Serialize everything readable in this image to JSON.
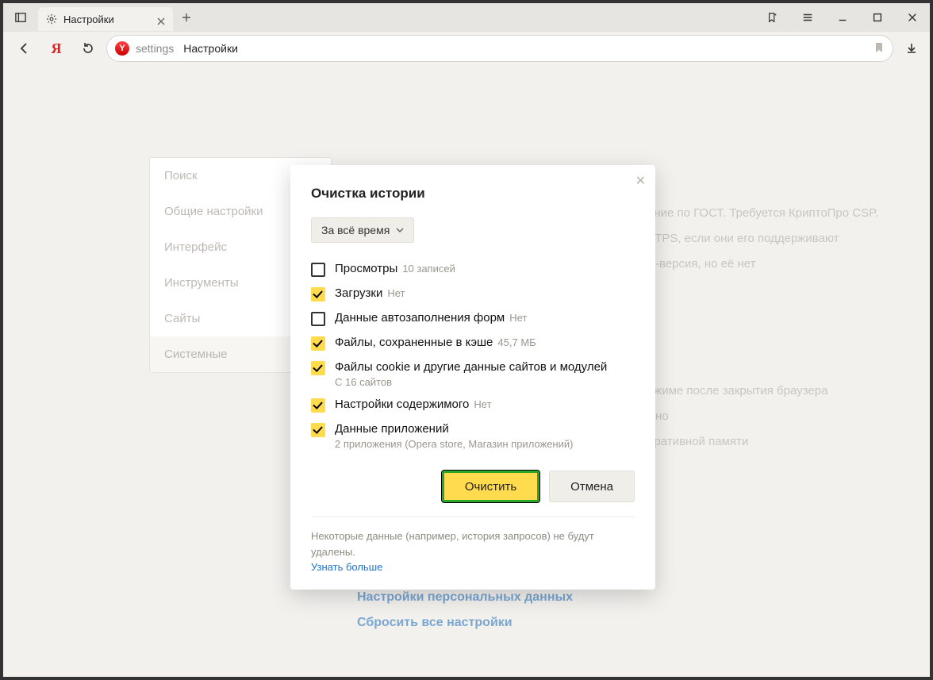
{
  "tab": {
    "title": "Настройки"
  },
  "omnibox": {
    "seg1": "settings",
    "seg2": "Настройки"
  },
  "sidebar": {
    "items": [
      "Поиск",
      "Общие настройки",
      "Интерфейс",
      "Инструменты",
      "Сайты",
      "Системные"
    ]
  },
  "background": {
    "line1": "ание по ГОСТ. Требуется КриптоПро CSP.",
    "line2": "TTPS, если они его поддерживают",
    "line3": "S-версия, но её нет",
    "line4": "ежиме после закрытия браузера",
    "line5": "жно",
    "line6": "еративной памяти",
    "link1": "Настройки персональных данных",
    "link2": "Сбросить все настройки"
  },
  "modal": {
    "title": "Очистка истории",
    "time_range": "За всё время",
    "options": [
      {
        "checked": false,
        "label": "Просмотры",
        "hint": "10 записей",
        "sub": ""
      },
      {
        "checked": true,
        "label": "Загрузки",
        "hint": "Нет",
        "sub": ""
      },
      {
        "checked": false,
        "label": "Данные автозаполнения форм",
        "hint": "Нет",
        "sub": ""
      },
      {
        "checked": true,
        "label": "Файлы, сохраненные в кэше",
        "hint": "45,7 МБ",
        "sub": ""
      },
      {
        "checked": true,
        "label": "Файлы cookie и другие данные сайтов и модулей",
        "hint": "",
        "sub": "С 16 сайтов"
      },
      {
        "checked": true,
        "label": "Настройки содержимого",
        "hint": "Нет",
        "sub": ""
      },
      {
        "checked": true,
        "label": "Данные приложений",
        "hint": "",
        "sub": "2 приложения (Opera store, Магазин приложений)"
      }
    ],
    "primary_btn": "Очистить",
    "cancel_btn": "Отмена",
    "footer_text": "Некоторые данные (например, история запросов) не будут удалены.",
    "footer_link": "Узнать больше"
  }
}
